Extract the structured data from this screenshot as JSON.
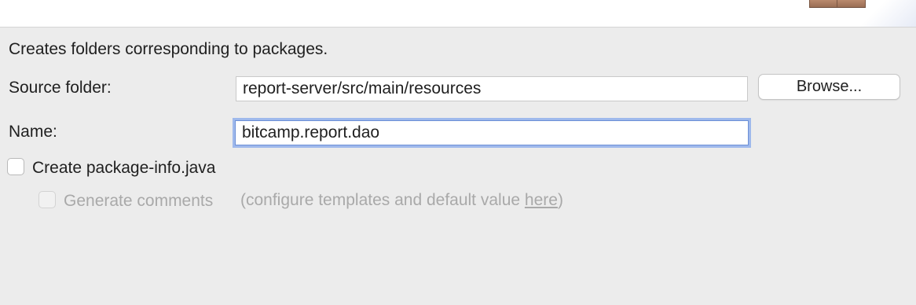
{
  "wizard": {
    "description": "Creates folders corresponding to packages."
  },
  "form": {
    "source_folder_label": "Source folder:",
    "source_folder_value": "report-server/src/main/resources",
    "browse_label": "Browse...",
    "name_label": "Name:",
    "name_value": "bitcamp.report.dao"
  },
  "options": {
    "create_package_info_label": "Create package-info.java",
    "create_package_info_checked": false,
    "generate_comments_label": "Generate comments",
    "generate_comments_checked": false,
    "generate_comments_enabled": false,
    "hint_prefix": "(configure templates and default value ",
    "hint_link": "here",
    "hint_suffix": ")"
  },
  "colors": {
    "background": "#ececec",
    "focus_ring": "#9fb9ec",
    "disabled_text": "#a9a9a9"
  }
}
